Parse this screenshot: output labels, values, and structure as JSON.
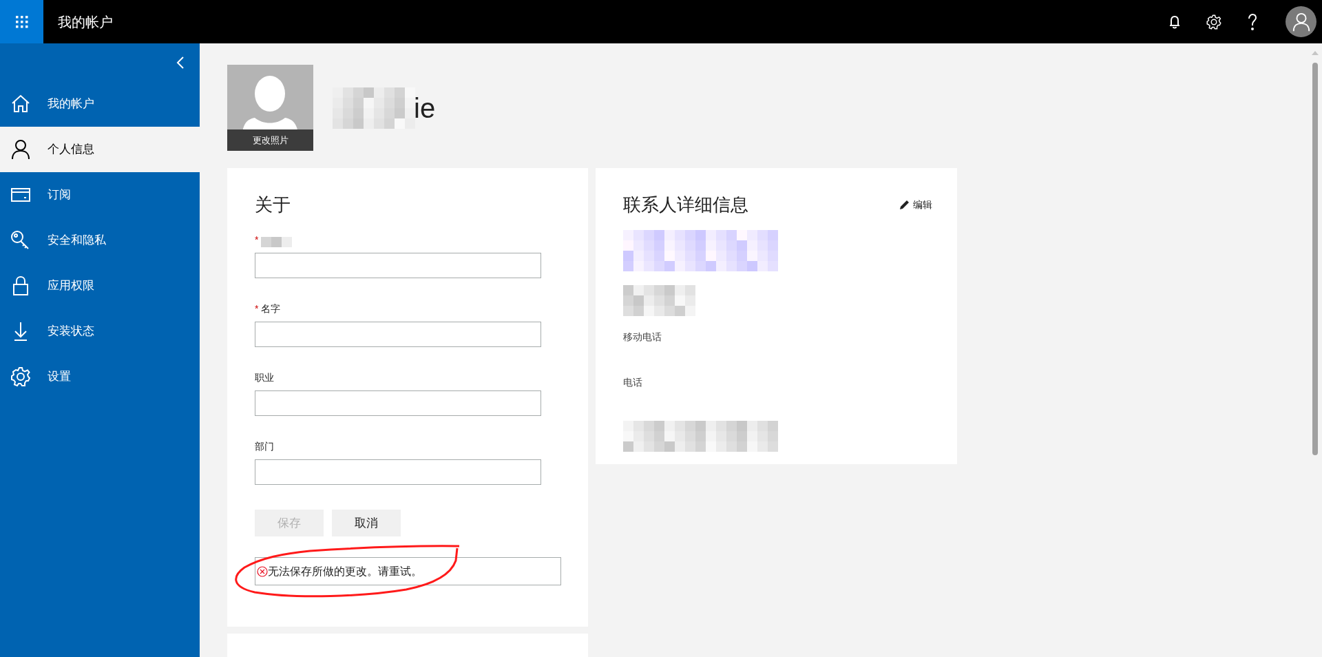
{
  "top_bar": {
    "title": "我的帐户"
  },
  "sidebar": {
    "items": [
      {
        "label": "我的帐户",
        "selected": false
      },
      {
        "label": "个人信息",
        "selected": true
      },
      {
        "label": "订阅",
        "selected": false
      },
      {
        "label": "安全和隐私",
        "selected": false
      },
      {
        "label": "应用权限",
        "selected": false
      },
      {
        "label": "安装状态",
        "selected": false
      },
      {
        "label": "设置",
        "selected": false
      }
    ]
  },
  "profile": {
    "photo_caption": "更改照片",
    "name_visible": "ie"
  },
  "about": {
    "title": "关于",
    "fields": [
      {
        "kind": "redacted",
        "marker": "*"
      },
      {
        "kind": "labeled",
        "label": "名字",
        "marker": "*"
      },
      {
        "kind": "labeled",
        "label": "职业"
      },
      {
        "kind": "labeled",
        "label": "部门"
      }
    ],
    "buttons": [
      {
        "label": "保存",
        "disabled": true
      },
      {
        "label": "取消",
        "disabled": false
      }
    ],
    "error": "无法保存所做的更改。请重试。"
  },
  "contact": {
    "title": "联系人详细信息",
    "edit": "编辑",
    "rows": [
      {
        "kind": "redacted"
      },
      {
        "kind": "redacted"
      },
      {
        "kind": "label",
        "label": "移动电话"
      },
      {
        "kind": "label",
        "label": "电话"
      },
      {
        "kind": "redacted"
      }
    ]
  }
}
